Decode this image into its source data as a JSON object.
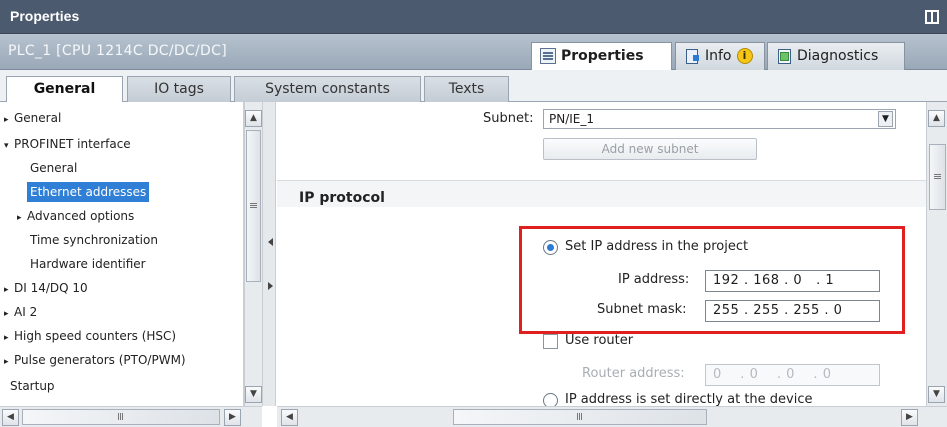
{
  "window": {
    "title": "Properties"
  },
  "object": {
    "name": "PLC_1 [CPU 1214C DC/DC/DC]"
  },
  "inspector_tabs": [
    {
      "label": "Properties",
      "icon": "properties-icon",
      "active": true
    },
    {
      "label": "Info",
      "icon": "info-icon",
      "active": false
    },
    {
      "label": "Diagnostics",
      "icon": "diagnostics-icon",
      "active": false
    }
  ],
  "section_tabs": [
    {
      "label": "General",
      "active": true
    },
    {
      "label": "IO tags",
      "active": false
    },
    {
      "label": "System constants",
      "active": false
    },
    {
      "label": "Texts",
      "active": false
    }
  ],
  "nav": {
    "items": [
      {
        "label": "General",
        "level": 0,
        "arrow": "▸"
      },
      {
        "label": "PROFINET interface",
        "level": 0,
        "arrow": "▾"
      },
      {
        "label": "General",
        "level": 1,
        "arrow": ""
      },
      {
        "label": "Ethernet addresses",
        "level": 1,
        "arrow": "",
        "selected": true
      },
      {
        "label": "Advanced options",
        "level": 1,
        "arrow": "▸"
      },
      {
        "label": "Time synchronization",
        "level": 1,
        "arrow": ""
      },
      {
        "label": "Hardware identifier",
        "level": 1,
        "arrow": ""
      },
      {
        "label": "DI 14/DQ 10",
        "level": 0,
        "arrow": "▸"
      },
      {
        "label": "AI 2",
        "level": 0,
        "arrow": "▸"
      },
      {
        "label": "High speed counters (HSC)",
        "level": 0,
        "arrow": "▸"
      },
      {
        "label": "Pulse generators (PTO/PWM)",
        "level": 0,
        "arrow": "▸"
      },
      {
        "label": "Startup",
        "level": 0,
        "arrow": ""
      }
    ]
  },
  "subnet": {
    "label": "Subnet:",
    "value": "PN/IE_1",
    "add_button": "Add new subnet"
  },
  "ip_protocol": {
    "heading": "IP protocol",
    "set_in_project_label": "Set IP address in the project",
    "ip_address_label": "IP address:",
    "ip_address_value": "192 . 168 . 0   . 1",
    "subnet_mask_label": "Subnet mask:",
    "subnet_mask_value": "255 . 255 . 255 . 0",
    "use_router_label": "Use router",
    "router_address_label": "Router address:",
    "router_address_value": "0    . 0    . 0    . 0",
    "set_at_device_label": "IP address is set directly at the device"
  },
  "colors": {
    "title_bar": "#4b5a6e",
    "selection": "#2f7fd6",
    "highlight_box": "#e0201f",
    "radio_dot": "#2a7ad6"
  }
}
